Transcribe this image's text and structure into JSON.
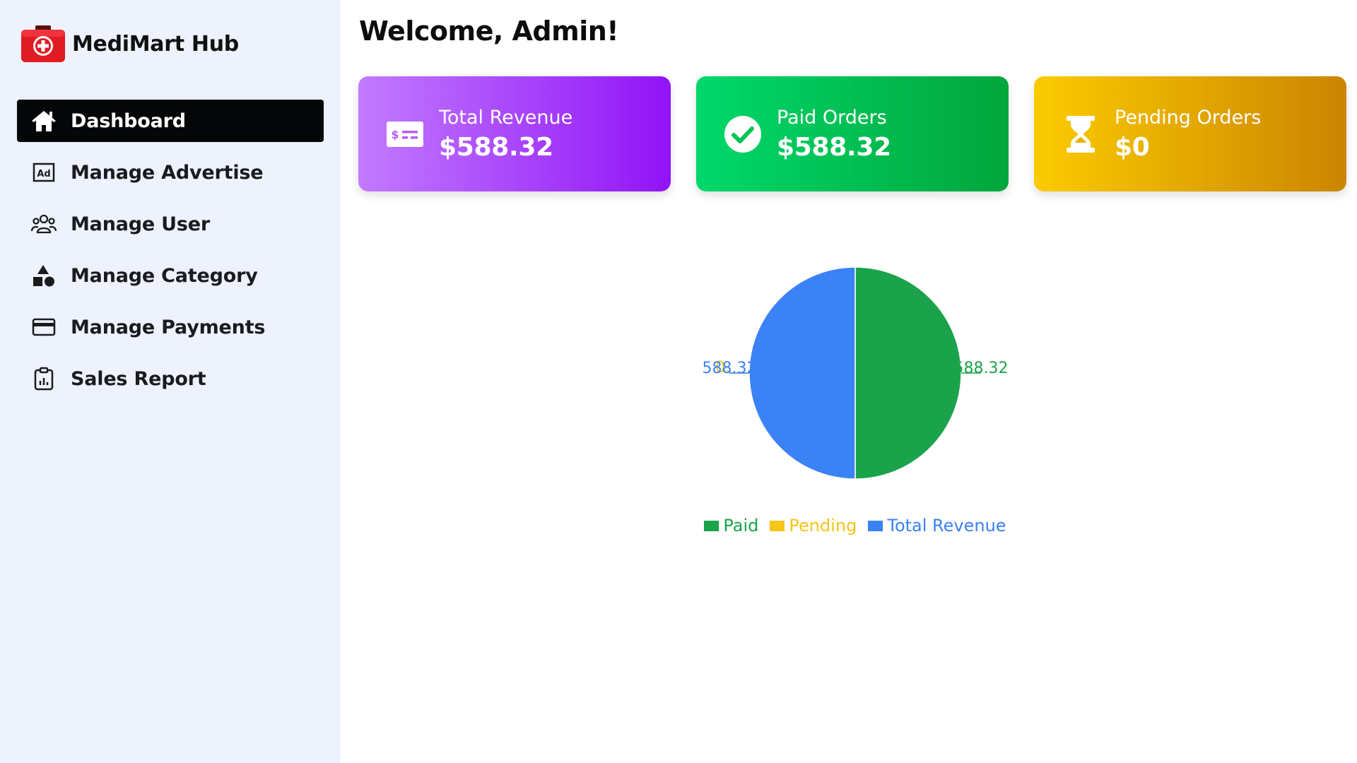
{
  "brand": {
    "name": "MediMart Hub"
  },
  "sidebar": {
    "items": [
      {
        "label": "Dashboard",
        "icon": "home-icon",
        "active": true
      },
      {
        "label": "Manage Advertise",
        "icon": "ad-icon",
        "active": false
      },
      {
        "label": "Manage User",
        "icon": "users-icon",
        "active": false
      },
      {
        "label": "Manage Category",
        "icon": "shapes-icon",
        "active": false
      },
      {
        "label": "Manage Payments",
        "icon": "credit-card-icon",
        "active": false
      },
      {
        "label": "Sales Report",
        "icon": "clipboard-chart-icon",
        "active": false
      }
    ]
  },
  "main": {
    "welcome": "Welcome, Admin!",
    "cards": [
      {
        "title": "Total Revenue",
        "value": "$588.32",
        "icon": "money-bill-icon"
      },
      {
        "title": "Paid Orders",
        "value": "$588.32",
        "icon": "check-circle-icon"
      },
      {
        "title": "Pending Orders",
        "value": "$0",
        "icon": "hourglass-icon"
      }
    ]
  },
  "colors": {
    "sidebar_bg": "#eef2fc",
    "active_nav": "#050608",
    "paid": "#1aa34a",
    "pending": "#f5c518",
    "total_revenue": "#3b82f6"
  },
  "chart_data": {
    "type": "pie",
    "categories": [
      "Paid",
      "Pending",
      "Total Revenue"
    ],
    "values": [
      588.32,
      0,
      588.32
    ],
    "labels": [
      "588.32",
      "0",
      "588.32"
    ],
    "colors": [
      "#1aa34a",
      "#f5c518",
      "#3b82f6"
    ],
    "legend": "bottom"
  }
}
